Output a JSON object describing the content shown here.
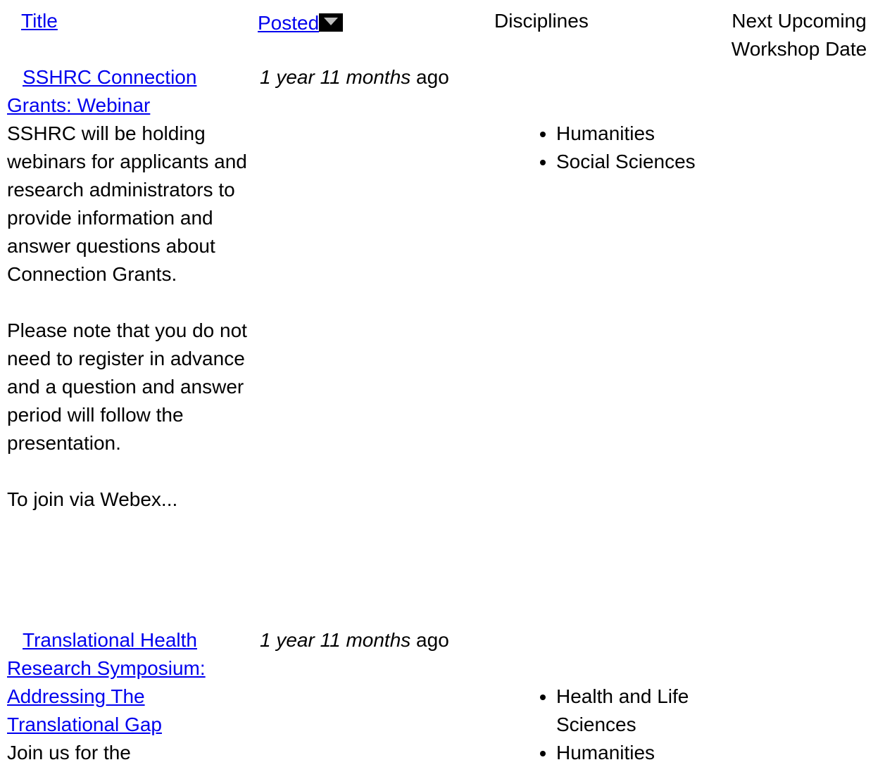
{
  "header": {
    "title_label": "Title",
    "posted_label": "Posted",
    "disciplines_label": "Disciplines",
    "next_date_label_line1": "Next Upcoming",
    "next_date_label_line2": "Workshop Date",
    "sort_icon": "sort-descending-icon"
  },
  "rows": [
    {
      "title_line1": "SSHRC Connection",
      "title_line2": "Grants: Webinar",
      "posted_em": "1 year 11 months",
      "posted_suffix": " ago",
      "teaser": [
        "SSHRC will be holding webinars for applicants and research administrators to provide information and answer questions about Connection Grants.",
        "Please note that you do not need to register in advance and a question and answer period will follow the presentation.",
        "To join via Webex..."
      ],
      "disciplines": [
        "Humanities",
        "Social Sciences"
      ]
    },
    {
      "title_line1": "Translational Health",
      "title_line2": "Research Symposium:",
      "title_line3": "Addressing The",
      "title_line4": "Translational Gap",
      "posted_em": "1 year 11 months",
      "posted_suffix": " ago",
      "teaser": [
        "Join us for the"
      ],
      "disciplines": [
        "Health and Life Sciences",
        "Humanities"
      ]
    }
  ],
  "colors": {
    "link": "#0000ee",
    "text": "#000000",
    "background": "#ffffff"
  }
}
